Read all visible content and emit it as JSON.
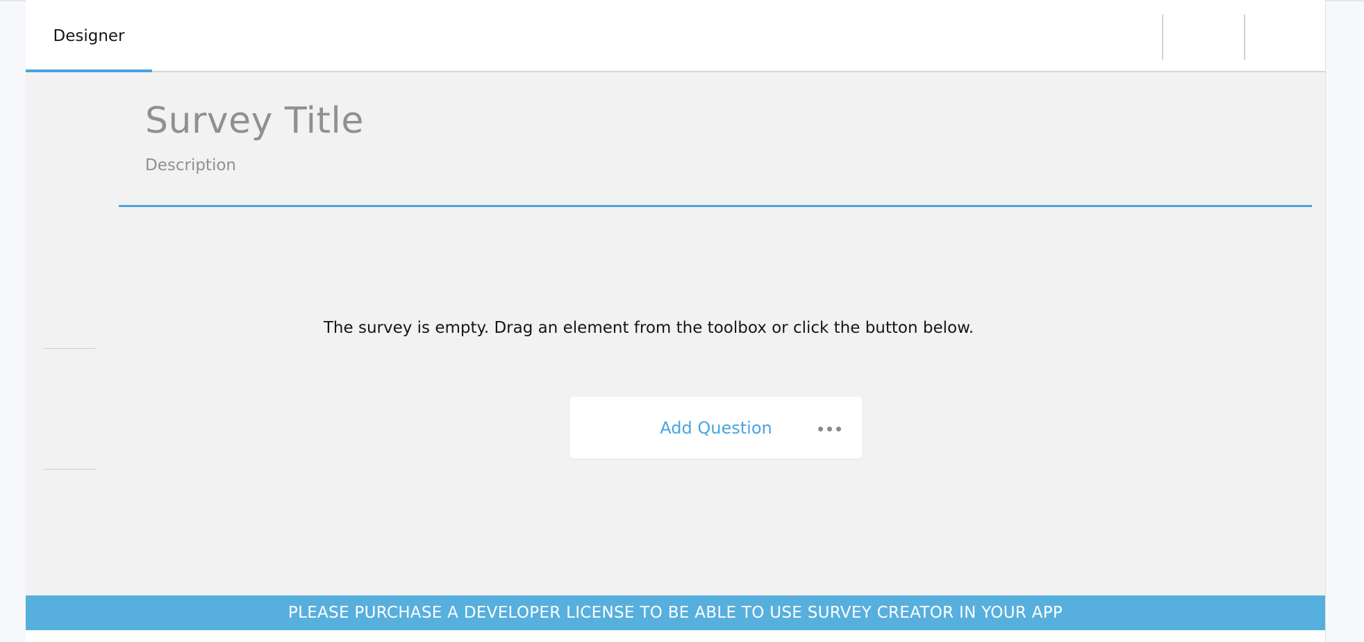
{
  "header": {
    "tabs": [
      {
        "label": "Designer",
        "active": true
      }
    ]
  },
  "survey": {
    "title": "Survey Title",
    "description": "Description"
  },
  "empty_state": {
    "message": "The survey is empty. Drag an element from the toolbox or click the button below.",
    "add_question_label": "Add Question",
    "more_icon": "ellipsis-icon"
  },
  "banner": {
    "text": "PLEASE PURCHASE A DEVELOPER LICENSE TO BE ABLE TO USE SURVEY CREATOR IN YOUR APP"
  },
  "colors": {
    "accent": "#4aa3df",
    "banner": "#57afdd",
    "canvas": "#f2f2f2",
    "placeholder_text": "#909090"
  }
}
